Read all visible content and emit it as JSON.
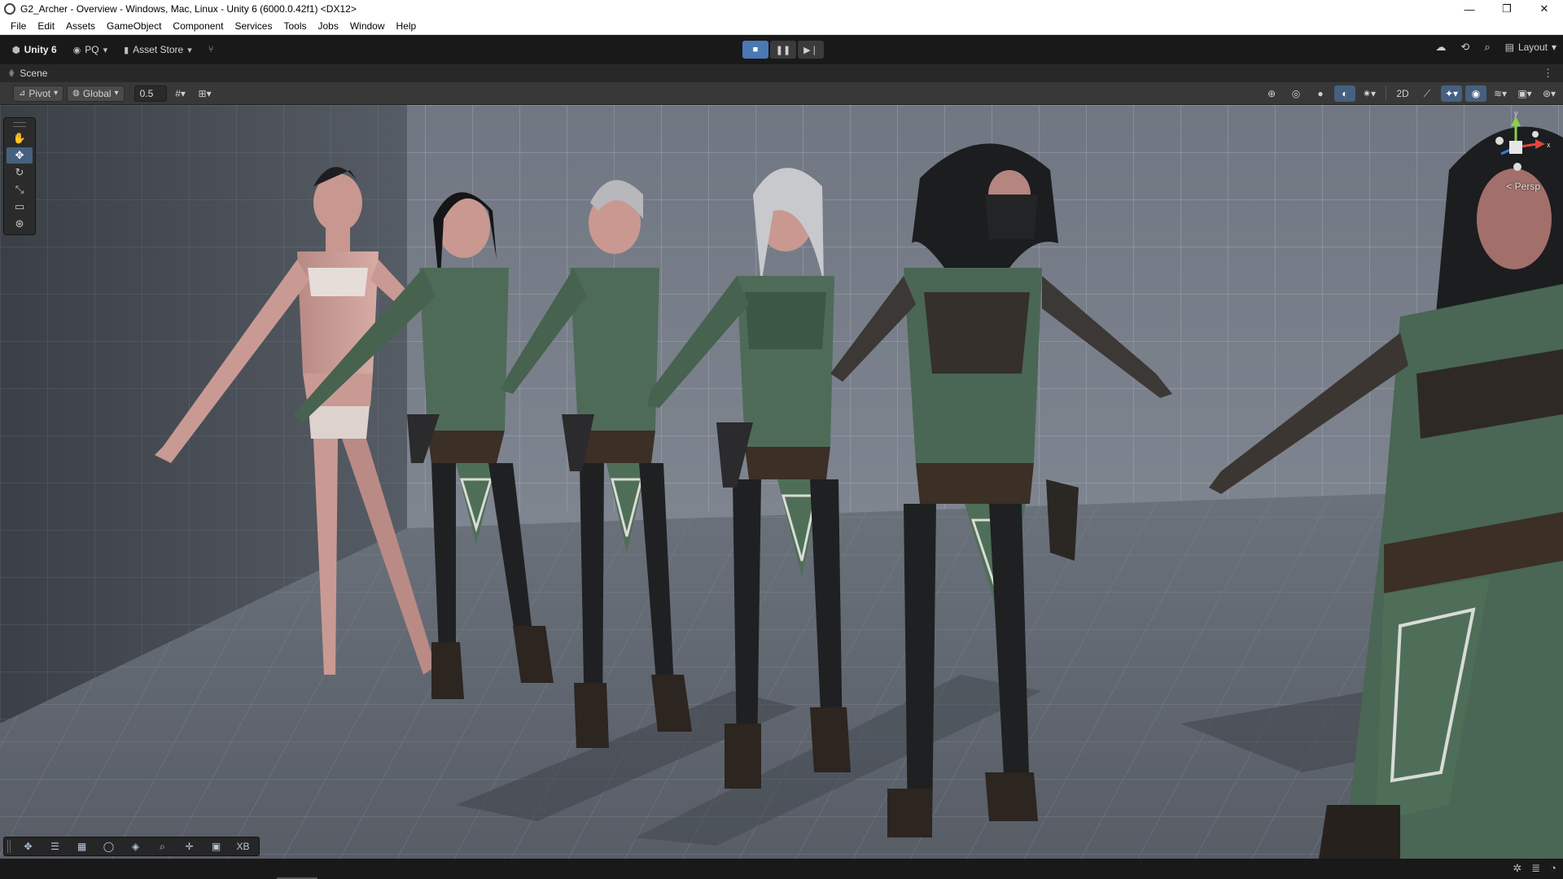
{
  "window": {
    "title": "G2_Archer - Overview - Windows, Mac, Linux - Unity 6 (6000.0.42f1) <DX12>",
    "controls": {
      "minimize": "—",
      "maximize": "❐",
      "close": "✕"
    }
  },
  "menu": [
    "File",
    "Edit",
    "Assets",
    "GameObject",
    "Component",
    "Services",
    "Tools",
    "Jobs",
    "Window",
    "Help"
  ],
  "toolbar": {
    "brand": "Unity 6",
    "account": "PQ",
    "asset_store": "Asset Store",
    "play_controls": {
      "play": "■",
      "pause": "❚❚",
      "step": "▶❘",
      "play_active": true
    },
    "layout": "Layout"
  },
  "scene_tab": {
    "label": "Scene"
  },
  "scene_toolbar": {
    "pivot": "Pivot",
    "global": "Global",
    "snap_value": "0.5",
    "toggle_2d": "2D"
  },
  "viewport": {
    "projection": "< Persp",
    "gizmo_axes": {
      "y": "y",
      "x": "x"
    },
    "character_count": 6
  },
  "tools": [
    "hand-tool",
    "move-tool",
    "rotate-tool",
    "scale-tool",
    "rect-tool",
    "transform-tool"
  ],
  "overlay_bottom": {
    "xb_label": "XB"
  },
  "colors": {
    "accent": "#4a78b5",
    "toolbar_bg": "#191919",
    "scene_toolbar_bg": "#383838",
    "outfit_green": "#4f6e58",
    "leather": "#3b2f26"
  }
}
